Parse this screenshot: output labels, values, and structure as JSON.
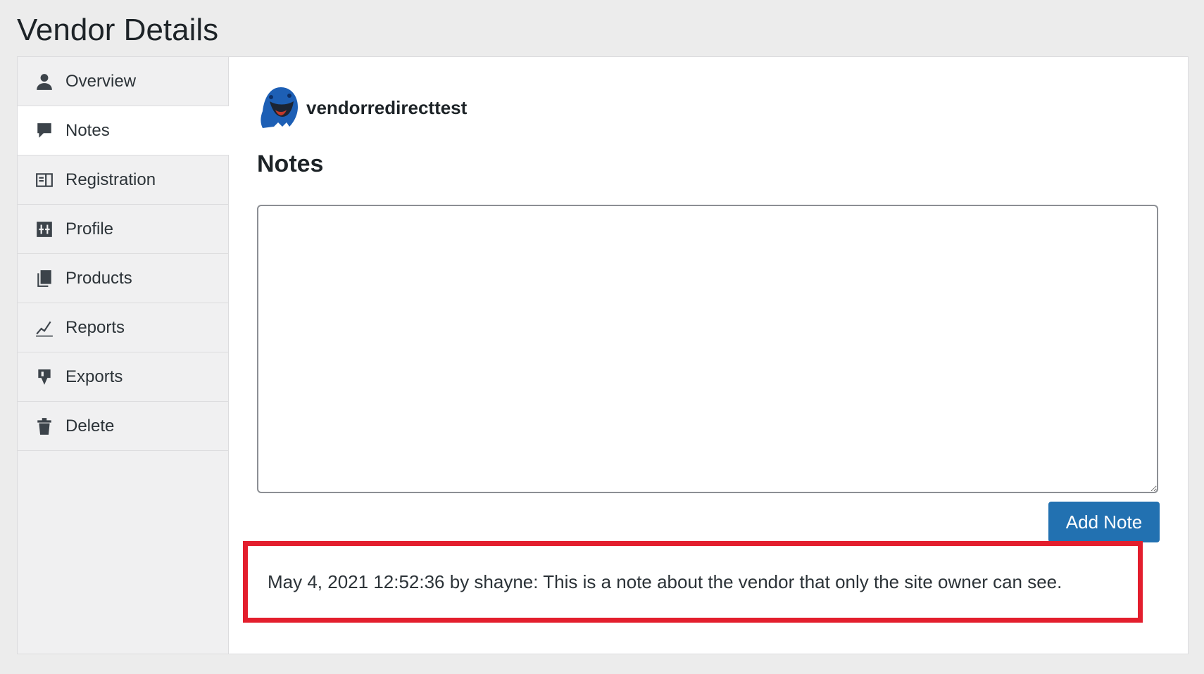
{
  "page": {
    "title": "Vendor Details"
  },
  "sidebar": {
    "items": [
      {
        "label": "Overview",
        "icon": "user-icon"
      },
      {
        "label": "Notes",
        "icon": "comment-icon"
      },
      {
        "label": "Registration",
        "icon": "id-card-icon"
      },
      {
        "label": "Profile",
        "icon": "sliders-icon"
      },
      {
        "label": "Products",
        "icon": "pages-icon"
      },
      {
        "label": "Reports",
        "icon": "chart-line-icon"
      },
      {
        "label": "Exports",
        "icon": "download-icon"
      },
      {
        "label": "Delete",
        "icon": "trash-icon"
      }
    ],
    "active": "Notes"
  },
  "vendor": {
    "name": "vendorredirecttest",
    "avatar_color": "#1d5fb5"
  },
  "notes": {
    "heading": "Notes",
    "textarea_value": "",
    "add_button_label": "Add Note",
    "entries": [
      {
        "text": "May 4, 2021 12:52:36 by shayne: This is a note about the vendor that only the site owner can see."
      }
    ]
  },
  "colors": {
    "accent": "#2271b1",
    "highlight_border": "#e31e2d",
    "background": "#ececec"
  }
}
